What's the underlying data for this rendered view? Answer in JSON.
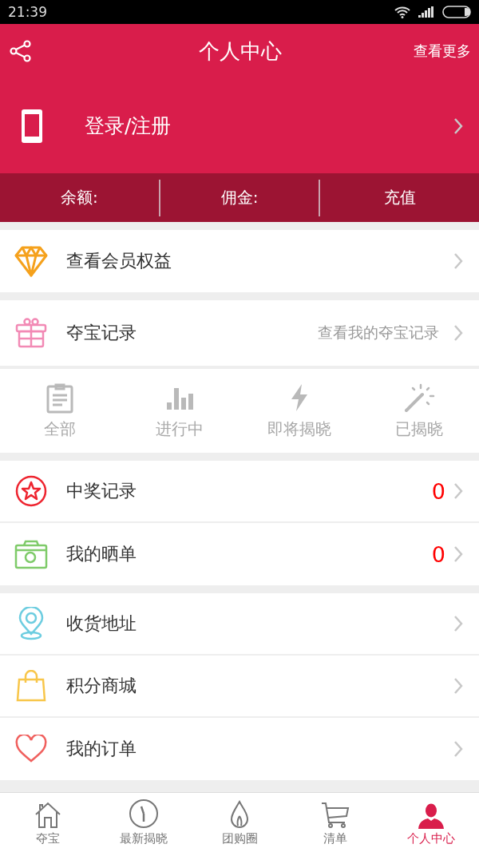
{
  "status_bar": {
    "time": "21:39"
  },
  "header": {
    "title": "个人中心",
    "more": "查看更多",
    "login": "登录/注册"
  },
  "balance_bar": [
    {
      "label": "余额:"
    },
    {
      "label": "佣金:"
    },
    {
      "label": "充值"
    }
  ],
  "sections": [
    {
      "rows": [
        {
          "label": "查看会员权益"
        }
      ]
    },
    {
      "rows": [
        {
          "label": "夺宝记录",
          "detail": "查看我的夺宝记录"
        }
      ],
      "statuses": [
        {
          "label": "全部"
        },
        {
          "label": "进行中"
        },
        {
          "label": "即将揭晓"
        },
        {
          "label": "已揭晓"
        }
      ]
    },
    {
      "rows": [
        {
          "label": "中奖记录",
          "count": "0"
        },
        {
          "label": "我的晒单",
          "count": "0"
        }
      ]
    },
    {
      "rows": [
        {
          "label": "收货地址"
        },
        {
          "label": "积分商城"
        },
        {
          "label": "我的订单"
        }
      ]
    }
  ],
  "tab_bar": [
    {
      "label": "夺宝",
      "selected": false
    },
    {
      "label": "最新揭晓",
      "selected": false
    },
    {
      "label": "团购圈",
      "selected": false
    },
    {
      "label": "清单",
      "selected": false
    },
    {
      "label": "个人中心",
      "selected": true
    }
  ]
}
